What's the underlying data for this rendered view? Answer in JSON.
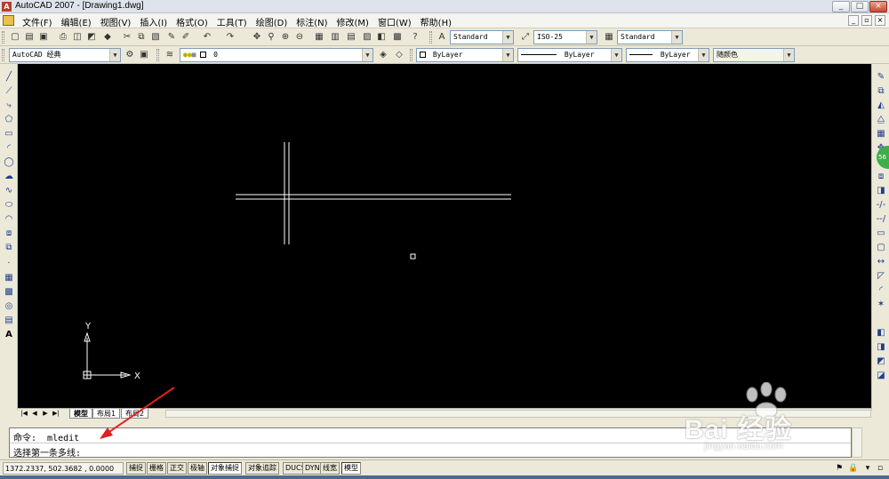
{
  "window": {
    "title": "AutoCAD 2007 - [Drawing1.dwg]",
    "minimize": "_",
    "maximize": "□",
    "close": "×"
  },
  "menu": {
    "items": [
      "文件(F)",
      "编辑(E)",
      "视图(V)",
      "插入(I)",
      "格式(O)",
      "工具(T)",
      "绘图(D)",
      "标注(N)",
      "修改(M)",
      "窗口(W)",
      "帮助(H)"
    ]
  },
  "toolbar": {
    "text_style": "Standard",
    "dim_style": "ISO-25",
    "table_style": "Standard",
    "workspace": "AutoCAD 经典",
    "layer": "0",
    "color": "ByLayer",
    "linetype": "ByLayer",
    "lineweight": "ByLayer",
    "plot_style": "随颜色"
  },
  "canvas": {
    "background": "#000000",
    "ucs_x_label": "X",
    "ucs_y_label": "Y"
  },
  "layout_tabs": {
    "tabs": [
      "模型",
      "布局1",
      "布局2"
    ]
  },
  "command": {
    "line1": "命令: _mledit",
    "line2": "选择第一条多线:"
  },
  "status": {
    "coords": "1372.2337, 502.3682 , 0.0000",
    "buttons": [
      "捕捉",
      "栅格",
      "正交",
      "极轴",
      "对象捕捉",
      "对象追踪",
      "DUCS",
      "DYN",
      "线宽",
      "模型"
    ]
  },
  "watermark": {
    "brand": "Bai  经验",
    "url": "jingyan.baidu.com"
  },
  "colors": {
    "annotation_arrow": "#e02020",
    "accent_green": "#3fae49"
  }
}
